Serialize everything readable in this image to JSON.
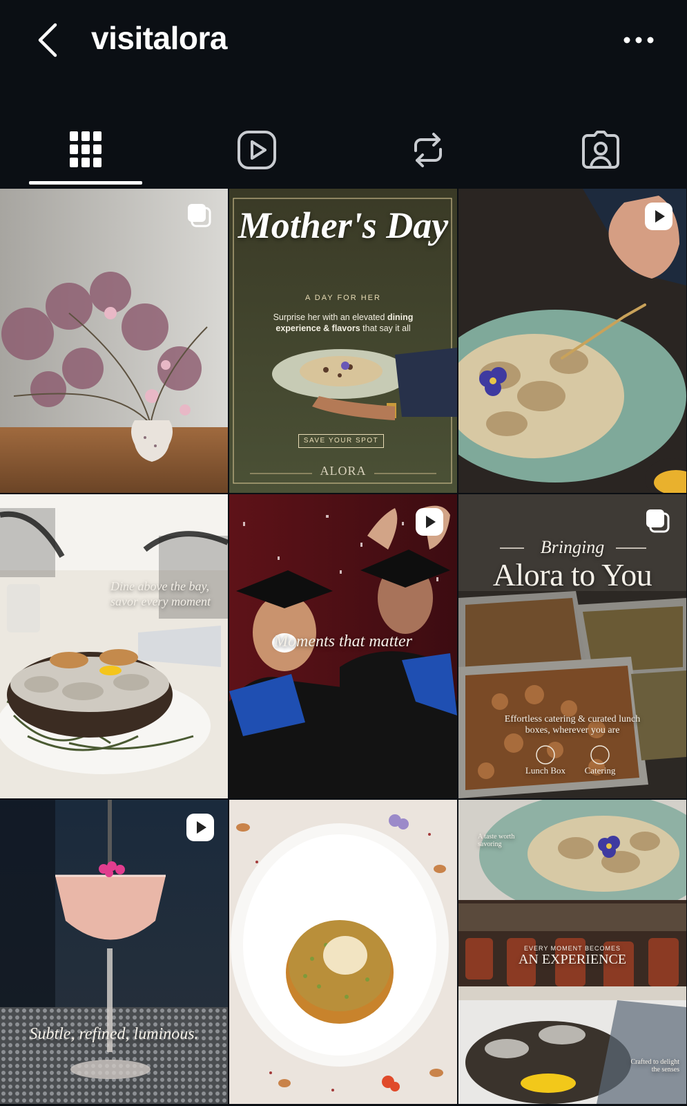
{
  "header": {
    "username": "visitalora"
  },
  "tabs": [
    {
      "icon": "grid-icon",
      "active": true
    },
    {
      "icon": "reels-icon",
      "active": false
    },
    {
      "icon": "reposts-icon",
      "active": false
    },
    {
      "icon": "tagged-icon",
      "active": false
    }
  ],
  "posts": [
    {
      "id": "post-1",
      "badge": "carousel-icon",
      "subject": "pink flower arrangement in a vase"
    },
    {
      "id": "post-2",
      "badge": "",
      "subject": "Mother's Day promo",
      "texts": {
        "script": "Mother's Day",
        "tagline": "A DAY FOR HER",
        "body_a": "Surprise her with an elevated ",
        "body_b": "dining",
        "body_c": "experience & flavors",
        "body_d": " that say it all",
        "cta": "SAVE YOUR SPOT",
        "brand": "ALORA"
      }
    },
    {
      "id": "post-3",
      "badge": "reel-icon",
      "subject": "dumplings on a teal plate with fork"
    },
    {
      "id": "post-4",
      "badge": "",
      "subject": "oysters on a table",
      "texts": {
        "line1": "Dine above the bay,",
        "line2": "savor every moment"
      }
    },
    {
      "id": "post-5",
      "badge": "reel-icon",
      "subject": "graduates celebrating with confetti",
      "texts": {
        "line1": "Moments that matter"
      }
    },
    {
      "id": "post-6",
      "badge": "carousel-icon",
      "subject": "catering trays",
      "texts": {
        "script": "Bringing",
        "headline": "Alora to You",
        "line1": "Effortless catering & curated lunch",
        "line2": "boxes, wherever you are",
        "opt1": "Lunch Box",
        "opt2": "Catering"
      }
    },
    {
      "id": "post-7",
      "badge": "reel-icon",
      "subject": "pink cocktail",
      "texts": {
        "line1": "Subtle, refined, luminous."
      }
    },
    {
      "id": "post-8",
      "badge": "",
      "subject": "kunafa dessert on white plate"
    },
    {
      "id": "post-9",
      "badge": "",
      "subject": "collage of dishes and dining room",
      "texts": {
        "small1": "A taste worth",
        "small2": "savoring",
        "kicker": "EVERY MOMENT BECOMES",
        "headline": "AN EXPERIENCE",
        "small3": "Crafted to delight",
        "small4": "the senses"
      }
    }
  ]
}
